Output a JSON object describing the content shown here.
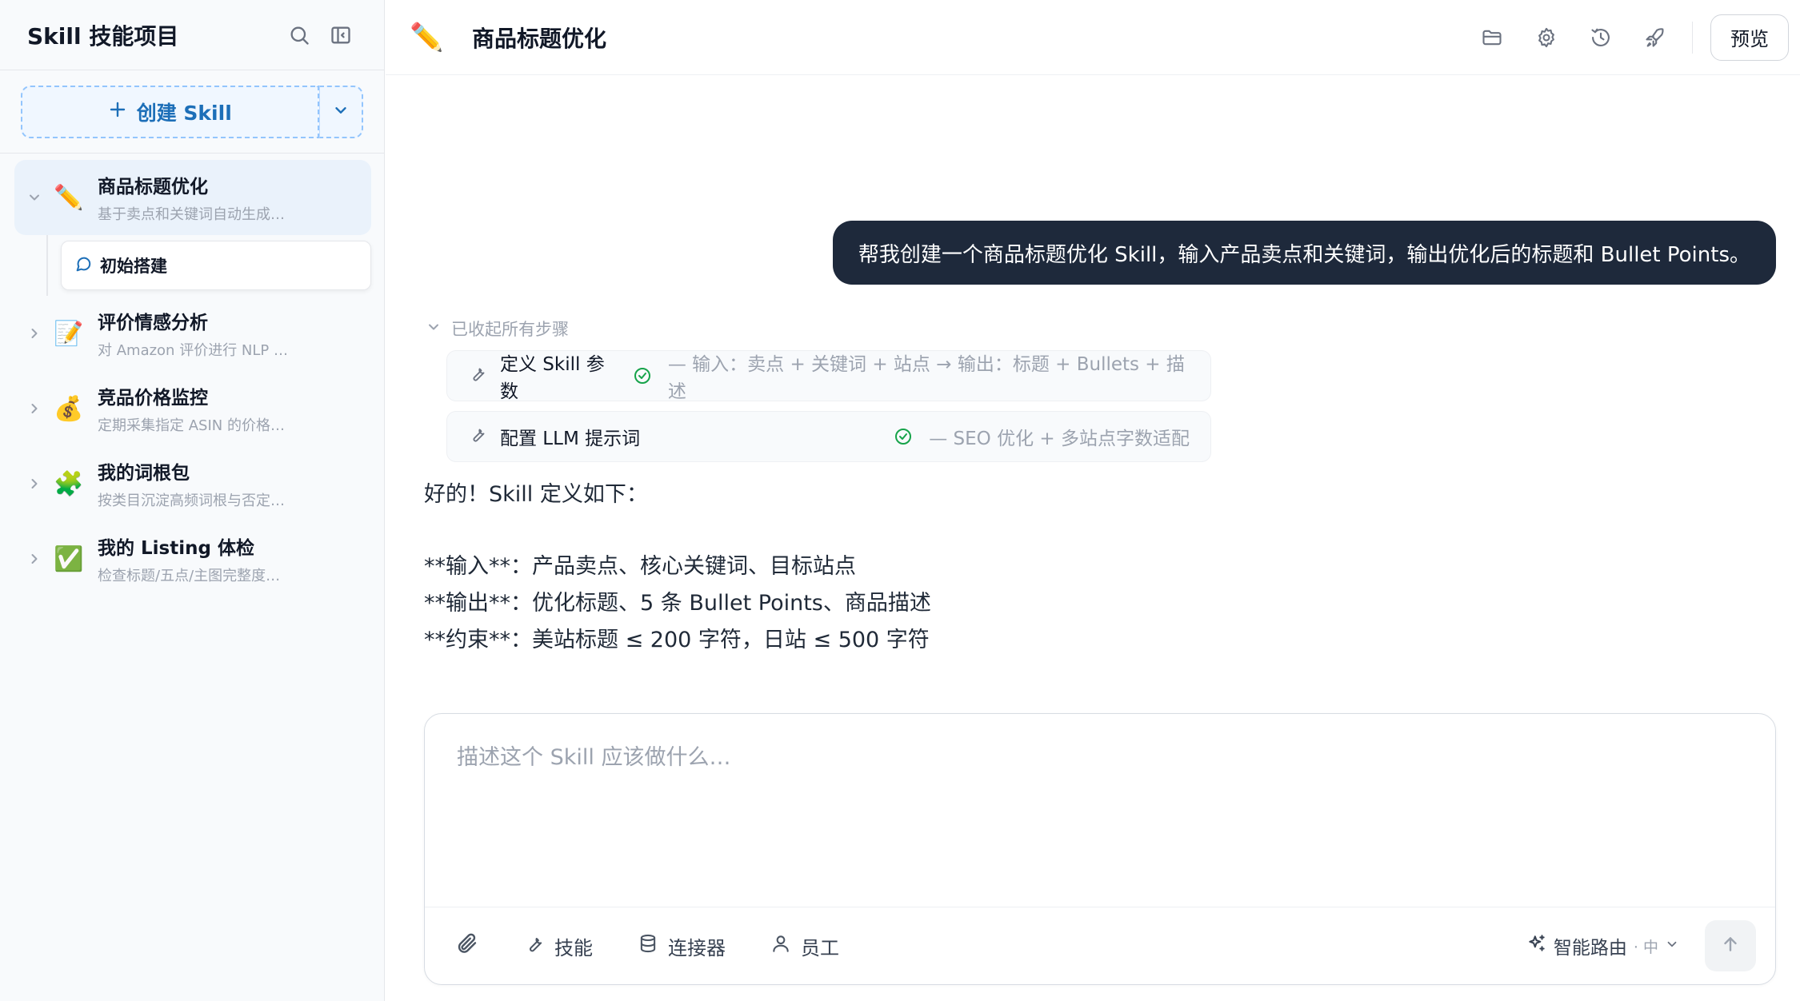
{
  "sidebar": {
    "title": "Skill 技能项目",
    "create_label": "创建 Skill",
    "skills": [
      {
        "emoji": "✏️",
        "name": "商品标题优化",
        "desc": "基于卖点和关键词自动生成…"
      },
      {
        "emoji": "📝",
        "name": "评价情感分析",
        "desc": "对 Amazon 评价进行 NLP …"
      },
      {
        "emoji": "💰",
        "name": "竞品价格监控",
        "desc": "定期采集指定 ASIN 的价格…"
      },
      {
        "emoji": "🧩",
        "name": "我的词根包",
        "desc": "按类目沉淀高频词根与否定…"
      },
      {
        "emoji": "✅",
        "name": "我的 Listing 体检",
        "desc": "检查标题/五点/主图完整度…"
      }
    ],
    "sub_item": "初始搭建"
  },
  "header": {
    "emoji": "✏️",
    "title": "商品标题优化",
    "preview_label": "预览",
    "icons": [
      "folder-icon",
      "gear-icon",
      "history-icon",
      "rocket-icon"
    ]
  },
  "chat": {
    "user_message": "帮我创建一个商品标题优化 Skill，输入产品卖点和关键词，输出优化后的标题和 Bullet Points。",
    "steps_toggle": "已收起所有步骤",
    "steps": [
      {
        "title": "定义 Skill 参数",
        "note": "— 输入：卖点 + 关键词 + 站点 → 输出：标题 + Bullets + 描述"
      },
      {
        "title": "配置 LLM 提示词",
        "note": "— SEO 优化 + 多站点字数适配"
      }
    ],
    "assistant_lines": [
      "好的！Skill 定义如下：",
      "**输入**：产品卖点、核心关键词、目标站点",
      "**输出**：优化标题、5 条 Bullet Points、商品描述",
      "**约束**：美站标题 ≤ 200 字符，日站 ≤ 500 字符"
    ]
  },
  "composer": {
    "placeholder": "描述这个 Skill 应该做什么…",
    "value": "",
    "tools": {
      "skills": "技能",
      "connectors": "连接器",
      "staff": "员工"
    },
    "route_label": "智能路由",
    "route_level": "· 中"
  },
  "colors": {
    "accent": "#1d6fb8",
    "bubble": "#1e293b",
    "success": "#16a34a"
  }
}
